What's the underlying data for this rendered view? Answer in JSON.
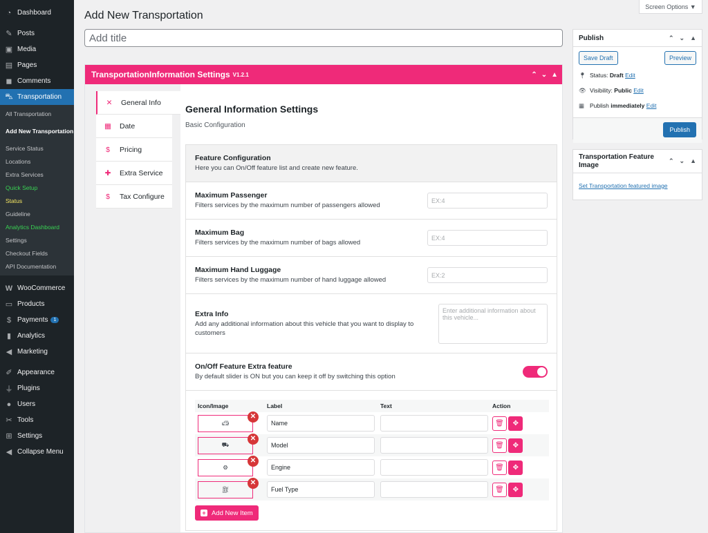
{
  "sidebar": {
    "items_top": [
      {
        "label": "Dashboard",
        "icon": "dashboard-icon"
      },
      {
        "label": "Posts",
        "icon": "pin-icon"
      },
      {
        "label": "Media",
        "icon": "media-icon"
      },
      {
        "label": "Pages",
        "icon": "pages-icon"
      },
      {
        "label": "Comments",
        "icon": "comment-icon"
      },
      {
        "label": "Transportation",
        "icon": "car-icon"
      }
    ],
    "submenu": [
      "All Transportation",
      "Add New Transportation",
      "Service Status",
      "Locations",
      "Extra Services",
      "Quick Setup",
      "Status",
      "Guideline",
      "Analytics Dashboard",
      "Settings",
      "Checkout Fields",
      "API Documentation"
    ],
    "items_bottom": [
      {
        "label": "WooCommerce",
        "icon": "woo-icon"
      },
      {
        "label": "Products",
        "icon": "archive-icon"
      },
      {
        "label": "Payments",
        "icon": "payments-icon",
        "badge": "1"
      },
      {
        "label": "Analytics",
        "icon": "bar-chart-icon"
      },
      {
        "label": "Marketing",
        "icon": "megaphone-icon"
      },
      {
        "label": "Appearance",
        "icon": "brush-icon"
      },
      {
        "label": "Plugins",
        "icon": "plugin-icon"
      },
      {
        "label": "Users",
        "icon": "user-icon"
      },
      {
        "label": "Tools",
        "icon": "wrench-icon"
      },
      {
        "label": "Settings",
        "icon": "settings-icon"
      },
      {
        "label": "Collapse Menu",
        "icon": "collapse-icon"
      }
    ]
  },
  "header": {
    "screen_options": "Screen Options ▼",
    "page_title": "Add New Transportation",
    "title_placeholder": "Add title"
  },
  "metabox": {
    "title": "TransportationInformation Settings",
    "version": "V1.2.1",
    "tabs": [
      {
        "label": "General Info",
        "icon": "tools-icon"
      },
      {
        "label": "Date",
        "icon": "calendar-icon"
      },
      {
        "label": "Pricing",
        "icon": "money-hand-icon"
      },
      {
        "label": "Extra Service",
        "icon": "puzzle-icon"
      },
      {
        "label": "Tax Configure",
        "icon": "money-hand-icon"
      }
    ],
    "section_title": "General Information Settings",
    "section_subtitle": "Basic Configuration",
    "feature_config": {
      "title": "Feature Configuration",
      "desc": "Here you can On/Off feature list and create new feature."
    },
    "rows": [
      {
        "label": "Maximum Passenger",
        "desc": "Filters services by the maximum number of passengers allowed",
        "placeholder": "EX:4"
      },
      {
        "label": "Maximum Bag",
        "desc": "Filters services by the maximum number of bags allowed",
        "placeholder": "EX:4"
      },
      {
        "label": "Maximum Hand Luggage",
        "desc": "Filters services by the maximum number of hand luggage allowed",
        "placeholder": "EX:2"
      }
    ],
    "extra_info": {
      "label": "Extra Info",
      "desc": "Add any additional information about this vehicle that you want to display to customers",
      "placeholder": "Enter additional information about this vehicle..."
    },
    "onoff": {
      "label": "On/Off Feature Extra feature",
      "desc": "By default slider is ON but you can keep it off by switching this option",
      "enabled": true
    },
    "table": {
      "headers": [
        "Icon/Image",
        "Label",
        "Text",
        "Action"
      ],
      "rows": [
        {
          "icon": "car-icon",
          "label": "Name",
          "text": ""
        },
        {
          "icon": "car-front-icon",
          "label": "Model",
          "text": ""
        },
        {
          "icon": "gears-icon",
          "label": "Engine",
          "text": ""
        },
        {
          "icon": "gas-pump-icon",
          "label": "Fuel Type",
          "text": ""
        }
      ],
      "add_button": "Add New Item"
    }
  },
  "publish": {
    "title": "Publish",
    "save_draft": "Save Draft",
    "preview": "Preview",
    "status_label": "Status:",
    "status_value": "Draft",
    "visibility_label": "Visibility:",
    "visibility_value": "Public",
    "publish_label": "Publish",
    "publish_value": "immediately",
    "edit": "Edit",
    "publish_button": "Publish"
  },
  "featured": {
    "title": "Transportation Feature Image",
    "link": "Set Transportation featured image"
  },
  "colors": {
    "accent": "#ef2a79",
    "wp_blue": "#2271b1",
    "sidebar_bg": "#1d2327"
  }
}
